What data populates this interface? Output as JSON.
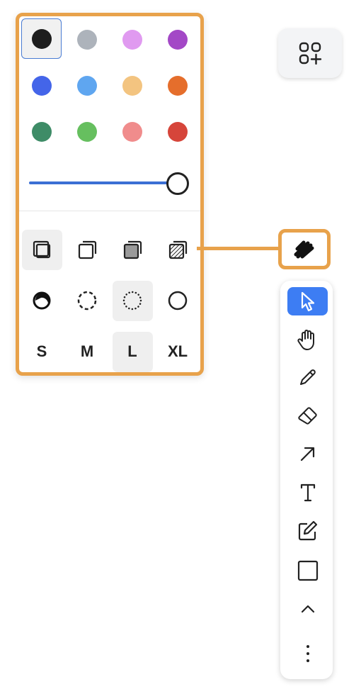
{
  "style_panel": {
    "colors": [
      {
        "name": "black",
        "hex": "#1d1d1d",
        "selected": true
      },
      {
        "name": "grey",
        "hex": "#adb3bb",
        "selected": false
      },
      {
        "name": "light-violet",
        "hex": "#e09af0",
        "selected": false
      },
      {
        "name": "violet",
        "hex": "#a348c6",
        "selected": false
      },
      {
        "name": "blue",
        "hex": "#4465e9",
        "selected": false
      },
      {
        "name": "light-blue",
        "hex": "#5fa6f0",
        "selected": false
      },
      {
        "name": "yellow",
        "hex": "#f3c480",
        "selected": false
      },
      {
        "name": "orange",
        "hex": "#e56e2c",
        "selected": false
      },
      {
        "name": "green",
        "hex": "#3e8c67",
        "selected": false
      },
      {
        "name": "light-green",
        "hex": "#66bf5f",
        "selected": false
      },
      {
        "name": "light-red",
        "hex": "#f08c8c",
        "selected": false
      },
      {
        "name": "red",
        "hex": "#d6453a",
        "selected": false
      }
    ],
    "opacity": 1.0,
    "fill_options": [
      {
        "name": "fill-none-icon",
        "active": true
      },
      {
        "name": "fill-semi-icon",
        "active": false
      },
      {
        "name": "fill-solid-icon",
        "active": false
      },
      {
        "name": "fill-pattern-icon",
        "active": false
      }
    ],
    "dash_options": [
      {
        "name": "dash-draw-icon",
        "active": false
      },
      {
        "name": "dash-dashed-icon",
        "active": false
      },
      {
        "name": "dash-dotted-icon",
        "active": true
      },
      {
        "name": "dash-solid-icon",
        "active": false
      }
    ],
    "sizes": [
      {
        "label": "S",
        "active": false
      },
      {
        "label": "M",
        "active": false
      },
      {
        "label": "L",
        "active": true
      },
      {
        "label": "XL",
        "active": false
      }
    ]
  },
  "accent_color": "#e8a24b",
  "selection_color": "#3d7df3",
  "top_button": {
    "icon": "add-shapes-icon"
  },
  "style_button": {
    "icon": "style-scribble-icon"
  },
  "toolbar": {
    "tools": [
      {
        "name": "select",
        "icon": "cursor-icon",
        "active": true
      },
      {
        "name": "hand",
        "icon": "hand-icon",
        "active": false
      },
      {
        "name": "draw",
        "icon": "pencil-icon",
        "active": false
      },
      {
        "name": "eraser",
        "icon": "eraser-icon",
        "active": false
      },
      {
        "name": "arrow",
        "icon": "arrow-icon",
        "active": false
      },
      {
        "name": "text",
        "icon": "text-icon",
        "active": false
      },
      {
        "name": "note",
        "icon": "note-icon",
        "active": false
      },
      {
        "name": "rectangle",
        "icon": "rectangle-icon",
        "active": false
      },
      {
        "name": "more-shapes",
        "icon": "chevron-up-icon",
        "active": false
      },
      {
        "name": "more",
        "icon": "more-vertical-icon",
        "active": false
      }
    ]
  }
}
